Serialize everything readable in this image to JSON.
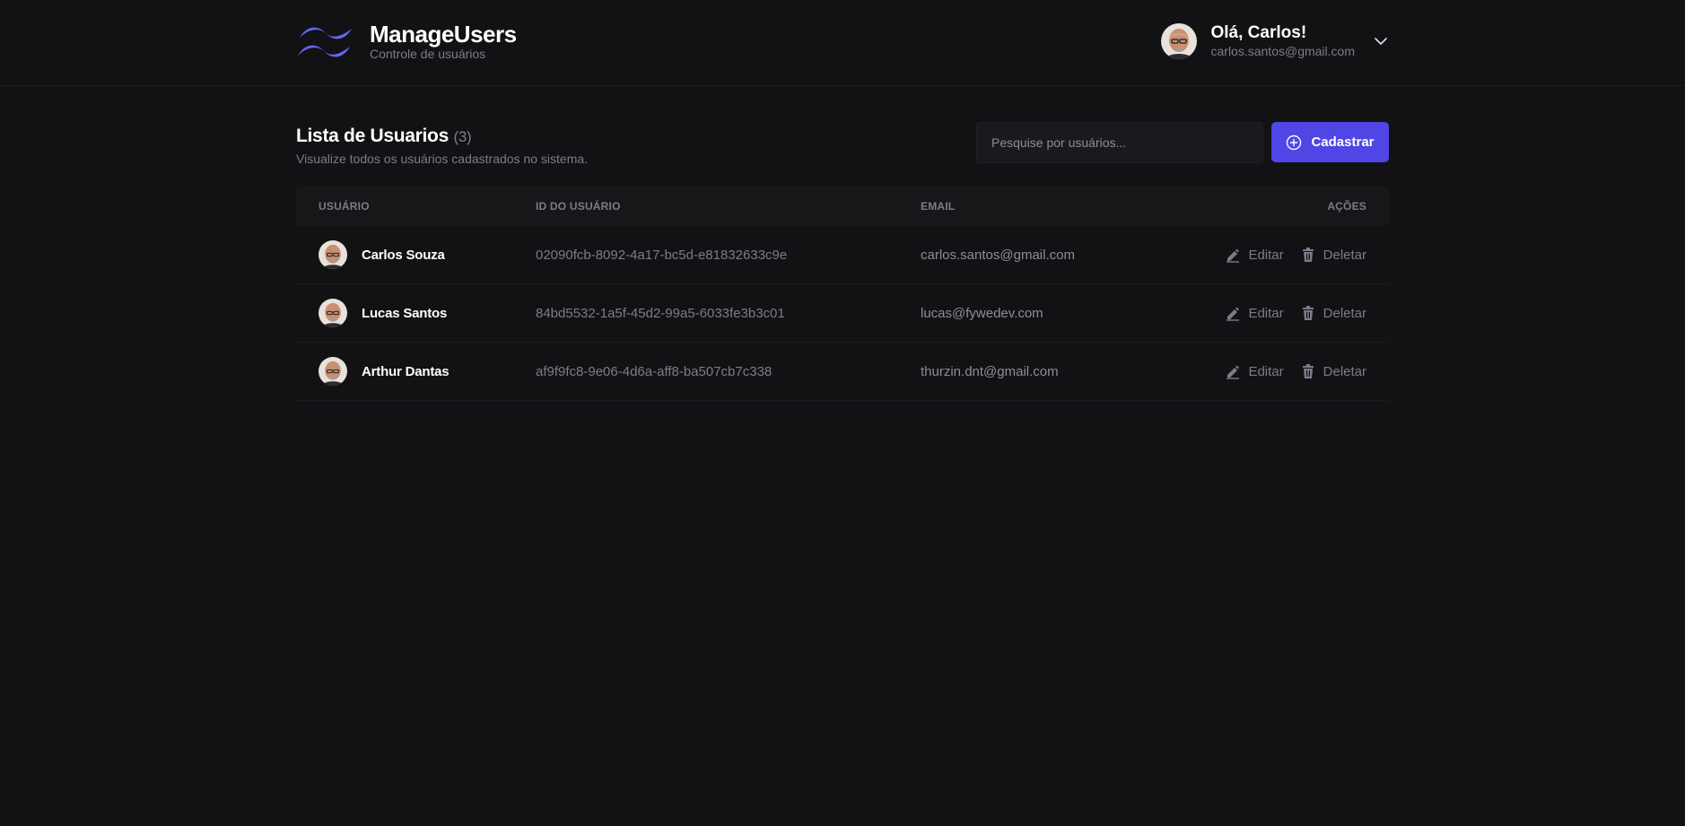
{
  "header": {
    "brand_title": "ManageUsers",
    "brand_subtitle": "Controle de usuários",
    "greeting": "Olá, Carlos!",
    "user_email": "carlos.santos@gmail.com"
  },
  "main": {
    "title": "Lista de Usuarios",
    "count": "(3)",
    "subtitle": "Visualize todos os usuários cadastrados no sistema.",
    "search_placeholder": "Pesquise por usuários...",
    "create_label": "Cadastrar"
  },
  "table": {
    "headers": {
      "user": "USUÁRIO",
      "id": "ID DO USUÁRIO",
      "email": "EMAIL",
      "actions": "AÇÕES"
    },
    "edit_label": "Editar",
    "delete_label": "Deletar",
    "rows": [
      {
        "name": "Carlos Souza",
        "id": "02090fcb-8092-4a17-bc5d-e81832633c9e",
        "email": "carlos.santos@gmail.com"
      },
      {
        "name": "Lucas Santos",
        "id": "84bd5532-1a5f-45d2-99a5-6033fe3b3c01",
        "email": "lucas@fywedev.com"
      },
      {
        "name": "Arthur Dantas",
        "id": "af9f9fc8-9e06-4d6a-aff8-ba507cb7c338",
        "email": "thurzin.dnt@gmail.com"
      }
    ]
  },
  "colors": {
    "background": "#121214",
    "accent": "#4f46e5",
    "logo": "#6366f1"
  }
}
